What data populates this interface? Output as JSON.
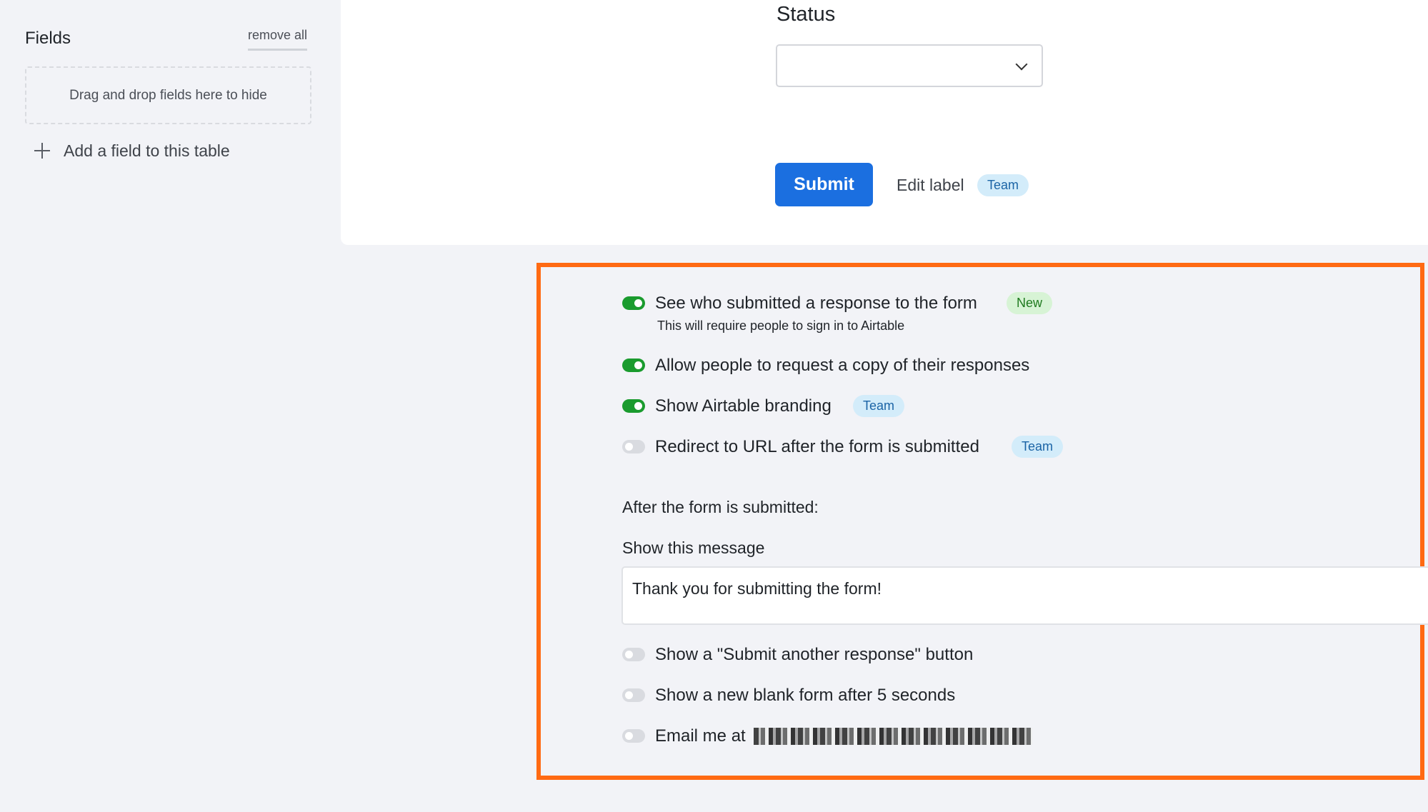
{
  "sidebar": {
    "title": "Fields",
    "remove_all": "remove all",
    "dropzone_text": "Drag and drop fields here to hide",
    "add_field": "Add a field to this table"
  },
  "form": {
    "status_label": "Status",
    "status_value": "",
    "submit_label": "Submit",
    "edit_label": "Edit label",
    "edit_badge": "Team"
  },
  "settings": {
    "options": [
      {
        "label": "See who submitted a response to the form",
        "badge": "New",
        "sub": "This will require people to sign in to Airtable",
        "on": true
      },
      {
        "label": "Allow people to request a copy of their responses",
        "on": true
      },
      {
        "label": "Show Airtable branding",
        "badge": "Team",
        "on": true
      },
      {
        "label": "Redirect to URL after the form is submitted",
        "badge": "Team",
        "on": false
      }
    ],
    "after_submit": "After the form is submitted:",
    "message_heading": "Show this message",
    "message_value": "Thank you for submitting the form!",
    "post_options": [
      {
        "label": "Show a \"Submit another response\" button",
        "on": false
      },
      {
        "label": "Show a new blank form after 5 seconds",
        "on": false
      },
      {
        "label": "Email me at",
        "on": false
      }
    ]
  },
  "colors": {
    "accent": "#1b6fe0",
    "toggle_on": "#1a9b2e",
    "highlight": "#ff6a13",
    "team_badge": "#d3ecfa",
    "new_badge": "#d7f3d5"
  }
}
